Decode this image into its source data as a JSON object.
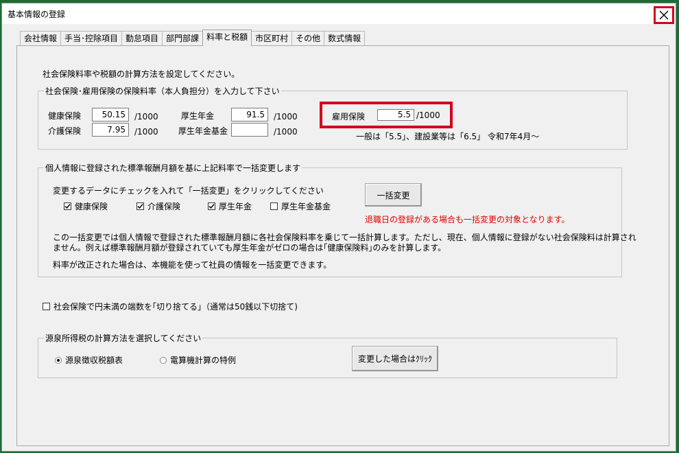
{
  "window": {
    "title": "基本情報の登録",
    "close_symbol": "✕"
  },
  "tabs": [
    {
      "label": "会社情報"
    },
    {
      "label": "手当･控除項目"
    },
    {
      "label": "勤怠項目"
    },
    {
      "label": "部門部課"
    },
    {
      "label": "料率と税額"
    },
    {
      "label": "市区町村"
    },
    {
      "label": "その他"
    },
    {
      "label": "数式情報"
    }
  ],
  "active_tab": "料率と税額",
  "instructions": "社会保険料率や税額の計算方法を設定してください。",
  "insurance_rates": {
    "legend": "社会保険･雇用保険の保険料率（本人負担分）を入力して下さい",
    "health": {
      "label": "健康保険",
      "value": "50.15",
      "unit": "/1000"
    },
    "care": {
      "label": "介護保険",
      "value": "7.95",
      "unit": "/1000"
    },
    "pension": {
      "label": "厚生年金",
      "value": "91.5",
      "unit": "/1000"
    },
    "pension_fund": {
      "label": "厚生年金基金",
      "value": "",
      "unit": "/1000"
    },
    "employment": {
      "label": "雇用保険",
      "value": "5.5",
      "unit": "/1000"
    },
    "employment_note": "一般は「5.5」、建設業等は「6.5」 令和7年4月～"
  },
  "bulk_change": {
    "legend": "個人情報に登録された標準報酬月額を基に上記料率で一括変更します",
    "instruction": "変更するデータにチェックを入れて「一括変更」をクリックしてください",
    "button": "一括変更",
    "checks": [
      {
        "label": "健康保険",
        "checked": true
      },
      {
        "label": "介護保険",
        "checked": true
      },
      {
        "label": "厚生年金",
        "checked": true
      },
      {
        "label": "厚生年金基金",
        "checked": false
      }
    ],
    "warning": "退職日の登録がある場合も一括変更の対象となります。",
    "description_1": "この一括変更では個人情報で登録された標準報酬月額に各社会保険料率を乗じて一括計算します。ただし、現在、個人情報に登録がない社会保険料は計算され",
    "description_2": "ません。例えば標準報酬月額が登録されていても厚生年金がゼロの場合は｢健康保険料｣のみを計算します。",
    "description_3": "料率が改正された場合は、本機能を使って社員の情報を一括変更できます。"
  },
  "round_down": {
    "label": "社会保険で円未満の端数を｢切り捨てる｣（通常は50銭以下切捨て)",
    "checked": false
  },
  "withholding": {
    "legend": "源泉所得税の計算方法を選択してください",
    "options": [
      {
        "label": "源泉徴収税額表",
        "selected": true
      },
      {
        "label": "電算機計算の特例",
        "selected": false
      }
    ],
    "button": "変更した場合はｸﾘｯｸ"
  },
  "colors": {
    "highlight": "#d0021b",
    "warning_text": "#e00000",
    "window_bg": "#f0f0f0",
    "desktop_bg": "#1f6b35"
  }
}
